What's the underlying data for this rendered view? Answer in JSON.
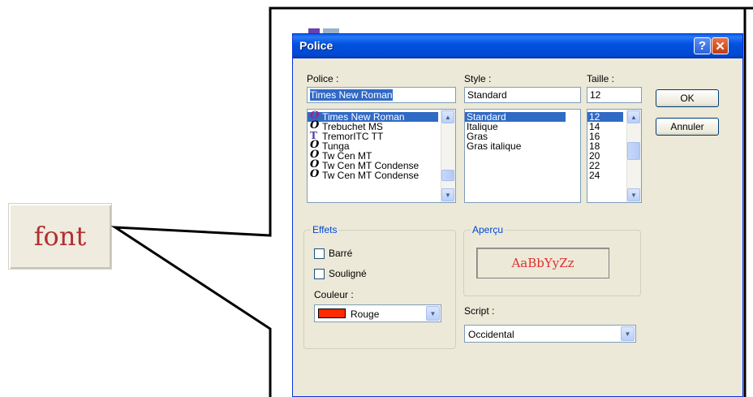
{
  "font_button": {
    "label": "font"
  },
  "dialog": {
    "title": "Police",
    "help_label": "?",
    "close_label": "✕"
  },
  "font": {
    "label": "Police :",
    "value": "Times New Roman",
    "items": [
      {
        "name": "Times New Roman",
        "icon": "opentype-icon",
        "glyph": "O"
      },
      {
        "name": "Trebuchet MS",
        "icon": "opentype-icon",
        "glyph": "O"
      },
      {
        "name": "TremorITC TT",
        "icon": "truetype-icon",
        "glyph": "T"
      },
      {
        "name": "Tunga",
        "icon": "opentype-icon",
        "glyph": "O"
      },
      {
        "name": "Tw Cen MT",
        "icon": "opentype-icon",
        "glyph": "O"
      },
      {
        "name": "Tw Cen MT Condense",
        "icon": "opentype-icon",
        "glyph": "O"
      },
      {
        "name": "Tw Cen MT Condense",
        "icon": "opentype-icon",
        "glyph": "O"
      }
    ]
  },
  "style": {
    "label": "Style :",
    "value": "Standard",
    "items": [
      "Standard",
      "Italique",
      "Gras",
      "Gras italique"
    ]
  },
  "size": {
    "label": "Taille :",
    "value": "12",
    "items": [
      "12",
      "14",
      "16",
      "18",
      "20",
      "22",
      "24"
    ]
  },
  "buttons": {
    "ok": "OK",
    "cancel": "Annuler"
  },
  "effects": {
    "title": "Effets",
    "strikethrough": "Barré",
    "underline": "Souligné",
    "color_label": "Couleur :",
    "color_value": "Rouge",
    "color_hex": "#ff2a00"
  },
  "preview": {
    "title": "Aperçu",
    "sample": "AaBbYyZz",
    "color": "#e03030"
  },
  "script": {
    "label": "Script :",
    "value": "Occidental"
  },
  "colors": {
    "accent": "#0046d5",
    "selection": "#316ac5"
  }
}
